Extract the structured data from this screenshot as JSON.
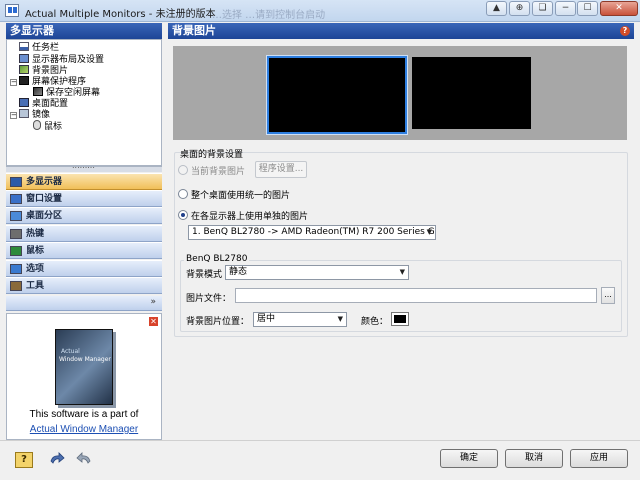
{
  "window": {
    "title": "Actual Multiple Monitors - 未注册的版本",
    "faded_background_text": "…选择  …请到控制台启动",
    "buttons": [
      "▲",
      "⊕",
      "❏",
      "−",
      "☐",
      "✕"
    ]
  },
  "left_panel": {
    "header": "多显示器",
    "tree": [
      {
        "label": "任务栏",
        "icon": "taskbar-icon",
        "level": 1,
        "expander": ""
      },
      {
        "label": "显示器布局及设置",
        "icon": "monitor-layout-icon",
        "level": 1,
        "expander": ""
      },
      {
        "label": "背景图片",
        "icon": "wallpaper-icon",
        "level": 1,
        "expander": ""
      },
      {
        "label": "屏幕保护程序",
        "icon": "screensaver-icon",
        "level": 1,
        "expander": "−"
      },
      {
        "label": "保存空闲屏幕",
        "icon": "idle-screen-icon",
        "level": 2,
        "expander": ""
      },
      {
        "label": "桌面配置",
        "icon": "desktop-profile-icon",
        "level": 1,
        "expander": ""
      },
      {
        "label": "镜像",
        "icon": "mirror-icon",
        "level": 1,
        "expander": "−"
      },
      {
        "label": "鼠标",
        "icon": "mouse-icon",
        "level": 2,
        "expander": ""
      }
    ],
    "nav": [
      {
        "label": "多显示器",
        "icon": "multi-monitor-icon",
        "color": "#2c5aa8",
        "active": true
      },
      {
        "label": "窗口设置",
        "icon": "window-settings-icon",
        "color": "#3a70c8",
        "active": false
      },
      {
        "label": "桌面分区",
        "icon": "desktop-divider-icon",
        "color": "#4b8ad8",
        "active": false
      },
      {
        "label": "热键",
        "icon": "hotkey-icon",
        "color": "#6d6d6d",
        "active": false
      },
      {
        "label": "鼠标",
        "icon": "mouse-nav-icon",
        "color": "#2d8a3a",
        "active": false
      },
      {
        "label": "选项",
        "icon": "options-icon",
        "color": "#3a7ad0",
        "active": false
      },
      {
        "label": "工具",
        "icon": "tools-icon",
        "color": "#8a6a3a",
        "active": false
      }
    ],
    "more_chevron": "»",
    "promo": {
      "close": "✕",
      "text": "This software is a part of",
      "link": "Actual Window Manager"
    }
  },
  "right_panel": {
    "header": "背景图片",
    "help": "?",
    "group_title": "桌面的背景设置",
    "options": {
      "current_bg": "当前背景图片",
      "program_settings": "程序设置...",
      "whole_desktop": "整个桌面使用统一的图片",
      "per_monitor": "在各显示器上使用单独的图片"
    },
    "monitor_select": "1. BenQ BL2780 -> AMD Radeon(TM) R7 200 Series Graphics",
    "monitor_section": {
      "title": "BenQ BL2780",
      "bg_mode_label": "背景模式",
      "bg_mode_value": "静态",
      "file_label": "图片文件：",
      "file_value": "",
      "browse": "...",
      "position_label": "背景图片位置：",
      "position_value": "居中",
      "color_label": "颜色：",
      "color_value": "#000000"
    }
  },
  "footer": {
    "ok": "确定",
    "cancel": "取消",
    "apply": "应用"
  }
}
